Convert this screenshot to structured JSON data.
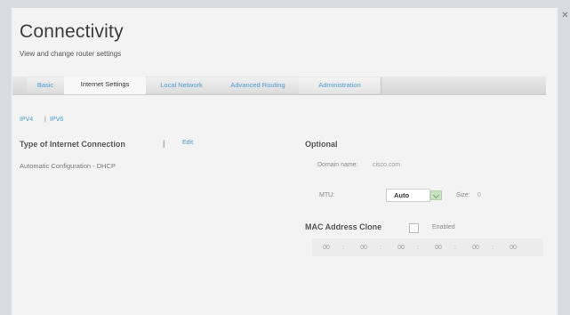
{
  "header": {
    "title": "Connectivity",
    "subtitle": "View and change router settings"
  },
  "tabs": [
    {
      "label": "Basic",
      "active": false
    },
    {
      "label": "Internet Settings",
      "active": true
    },
    {
      "label": "Local Network",
      "active": false
    },
    {
      "label": "Advanced Routing",
      "active": false
    },
    {
      "label": "Administration",
      "active": false
    }
  ],
  "ip_versions": {
    "ipv4": "IPV4",
    "separator": "|",
    "ipv6": "IPV6"
  },
  "connection": {
    "title": "Type of Internet Connection",
    "separator": "|",
    "edit_label": "Edit",
    "value": "Automatic Configuration - DHCP"
  },
  "optional": {
    "title": "Optional",
    "domain_label": "Domain name:",
    "domain_value": "cisco.com",
    "mtu_label": "MTU:",
    "mtu_value": "Auto",
    "size_label": "Size:",
    "size_value": "0"
  },
  "mac_clone": {
    "title": "MAC Address Clone",
    "enabled_label": "Enabled",
    "enabled": false,
    "octets": [
      "00",
      "00",
      "00",
      "00",
      "00",
      "00"
    ],
    "separator": ":"
  },
  "colors": {
    "accent": "#4a9bd0",
    "background": "#f3f3f3"
  }
}
